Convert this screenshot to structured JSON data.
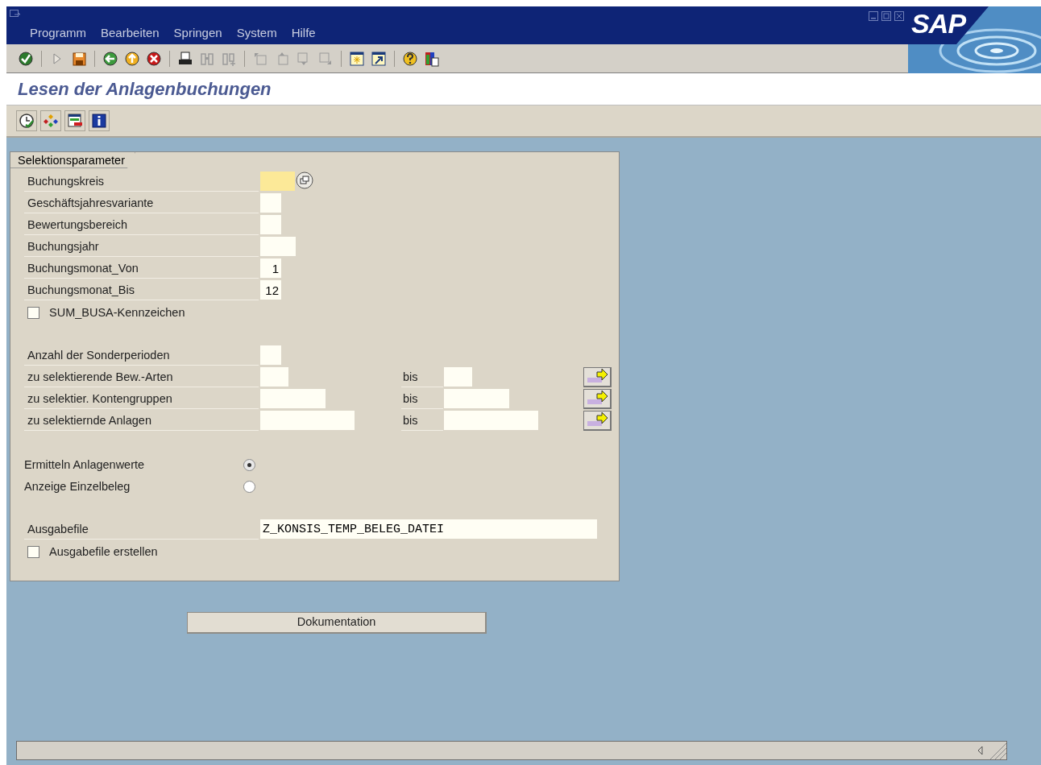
{
  "menu": [
    {
      "label": "Programm"
    },
    {
      "label": "Bearbeiten"
    },
    {
      "label": "Springen"
    },
    {
      "label": "System"
    },
    {
      "label": "Hilfe"
    }
  ],
  "logo": "SAP",
  "title": "Lesen der Anlagenbuchungen",
  "group_title": "Selektionsparameter",
  "sections": [
    [
      {
        "kind": "param",
        "label": "Buchungskreis",
        "required": true
      },
      {
        "kind": "param",
        "label": "Geschäftsjahresvariante",
        "required": false
      },
      {
        "kind": "param",
        "label": "Bewertungsbereich",
        "required": false
      },
      {
        "kind": "param",
        "label": "Buchungsjahr",
        "required": false
      },
      {
        "kind": "param",
        "label": "Buchungsmonat_Von",
        "value": "1",
        "required": false
      },
      {
        "kind": "param",
        "label": "Buchungsmonat_Bis",
        "value": "12",
        "required": false
      },
      {
        "kind": "checkbox",
        "label": "SUM_BUSA-Kennzeichen",
        "checked": false
      }
    ],
    [
      {
        "kind": "param",
        "label": "Anzahl der Sonderperioden",
        "required": false
      },
      {
        "kind": "range",
        "label": "zu selektierende Bew.-Arten",
        "to_label": "bis"
      },
      {
        "kind": "range",
        "label": "zu selektier. Kontengruppen",
        "to_label": "bis"
      },
      {
        "kind": "range",
        "label": "zu selektiernde Anlagen",
        "to_label": "bis"
      }
    ],
    [
      {
        "kind": "radio",
        "label": "Ermitteln Anlagenwerte",
        "selected": true
      },
      {
        "kind": "radio",
        "label": "Anzeige Einzelbeleg",
        "selected": false
      }
    ],
    [
      {
        "kind": "file",
        "label": "Ausgabefile",
        "value": "Z_KONSIS_TEMP_BELEG_DATEI"
      },
      {
        "kind": "checkbox",
        "label": "Ausgabefile erstellen",
        "checked": false
      }
    ]
  ],
  "doc_button": "Dokumentation"
}
